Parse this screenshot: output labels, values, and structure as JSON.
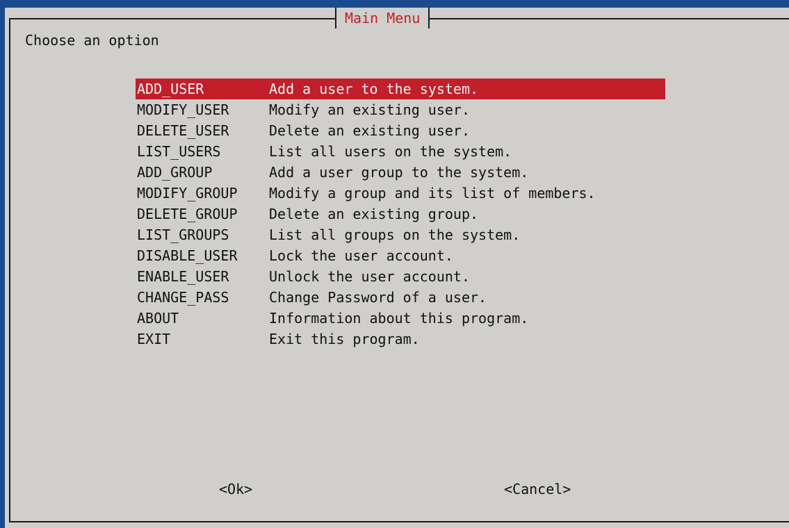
{
  "dialog": {
    "title": "Main Menu",
    "prompt": "Choose an option"
  },
  "menu": {
    "items": [
      {
        "tag": "ADD_USER",
        "desc": "Add a user to the system.",
        "selected": true
      },
      {
        "tag": "MODIFY_USER",
        "desc": "Modify an existing user."
      },
      {
        "tag": "DELETE_USER",
        "desc": "Delete an existing user."
      },
      {
        "tag": "LIST_USERS",
        "desc": "List all users on the system."
      },
      {
        "tag": "ADD_GROUP",
        "desc": "Add a user group to the system."
      },
      {
        "tag": "MODIFY_GROUP",
        "desc": "Modify a group and its list of members."
      },
      {
        "tag": "DELETE_GROUP",
        "desc": "Delete an existing group."
      },
      {
        "tag": "LIST_GROUPS",
        "desc": "List all groups on the system."
      },
      {
        "tag": "DISABLE_USER",
        "desc": "Lock the user account."
      },
      {
        "tag": "ENABLE_USER",
        "desc": "Unlock the user account."
      },
      {
        "tag": "CHANGE_PASS",
        "desc": "Change Password of a user."
      },
      {
        "tag": "ABOUT",
        "desc": "Information about this program."
      },
      {
        "tag": "EXIT",
        "desc": "Exit this program."
      }
    ]
  },
  "buttons": {
    "ok_label": "<Ok>",
    "cancel_label": "<Cancel>"
  },
  "colors": {
    "background": "#1a4b8c",
    "dialog": "#d0cfcc",
    "highlight": "#c21f2b",
    "title_text": "#c0202a"
  }
}
